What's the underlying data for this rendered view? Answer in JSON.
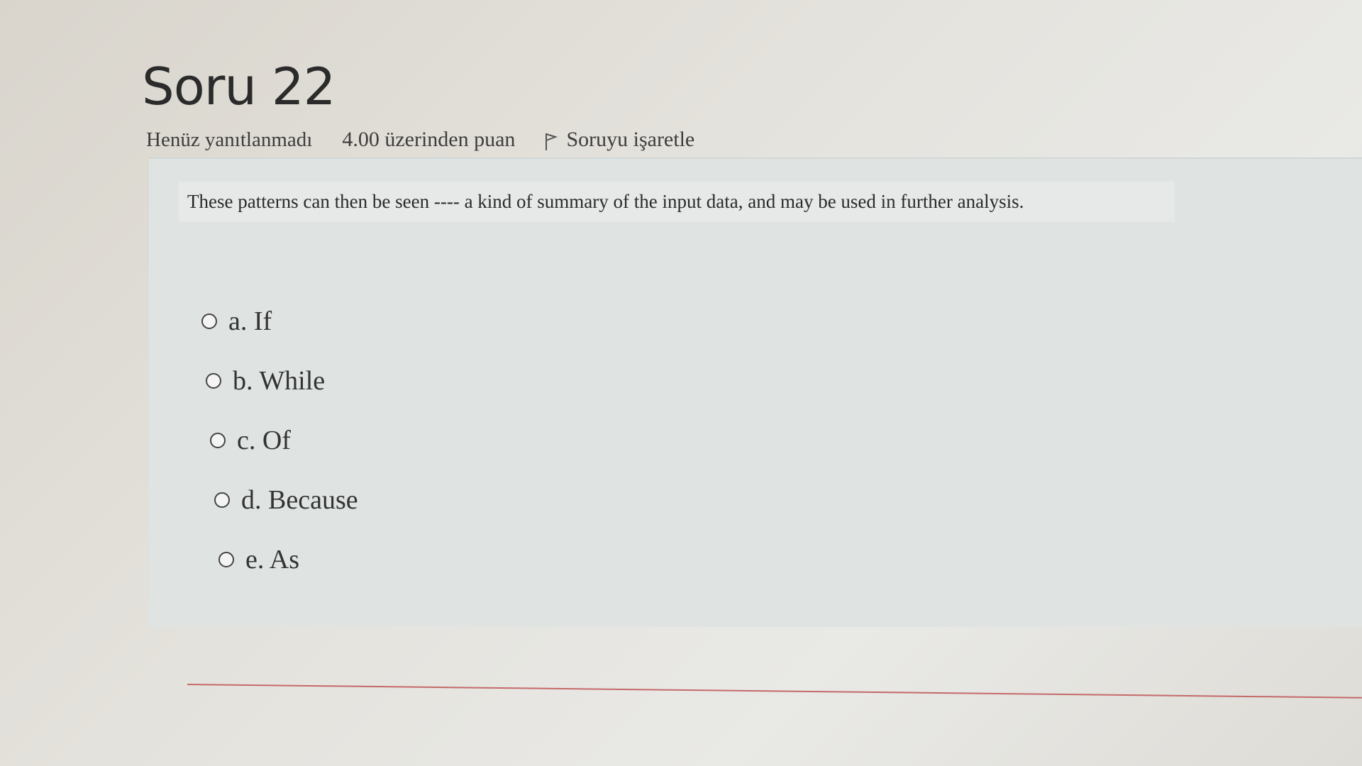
{
  "question": {
    "title": "Soru 22",
    "state": "Henüz yanıtlanmadı",
    "grade": "4.00 üzerinden puan",
    "flag_label": "Soruyu işaretle",
    "text": "These patterns can then be seen ---- a kind of summary of the input data, and may be used in further analysis.",
    "answers": [
      {
        "label": "a. If"
      },
      {
        "label": "b. While"
      },
      {
        "label": "c. Of"
      },
      {
        "label": "d. Because"
      },
      {
        "label": "e. As"
      }
    ]
  },
  "icons": {
    "flag": "flag-icon",
    "radio": "radio-unchecked-icon"
  },
  "colors": {
    "question_box": "#dfe4e2",
    "bottom_rule": "#c46a6a"
  }
}
